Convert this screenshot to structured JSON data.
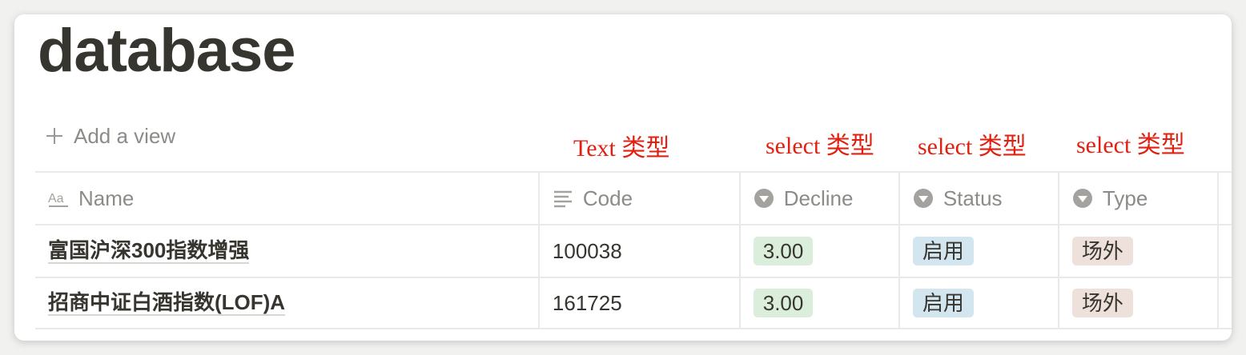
{
  "page": {
    "title": "database",
    "add_view_label": "Add a view"
  },
  "annotations": [
    "Text 类型",
    "select 类型",
    "select 类型",
    "select 类型"
  ],
  "table": {
    "headers": {
      "name": "Name",
      "code": "Code",
      "decline": "Decline",
      "status": "Status",
      "type": "Type"
    },
    "rows": [
      {
        "name": "富国沪深300指数增强",
        "code": "100038",
        "decline": "3.00",
        "status": "启用",
        "type": "场外"
      },
      {
        "name": "招商中证白酒指数(LOF)A",
        "code": "161725",
        "decline": "3.00",
        "status": "启用",
        "type": "场外"
      }
    ]
  },
  "colors": {
    "annotation": "#e02010",
    "tag_decline": "#dbeddb",
    "tag_status": "#d3e5ef",
    "tag_type": "#eee0da"
  },
  "icons": {
    "name_header": "text-title-icon",
    "code_header": "text-lines-icon",
    "select_header": "select-dropdown-icon",
    "add_view": "plus-icon"
  }
}
